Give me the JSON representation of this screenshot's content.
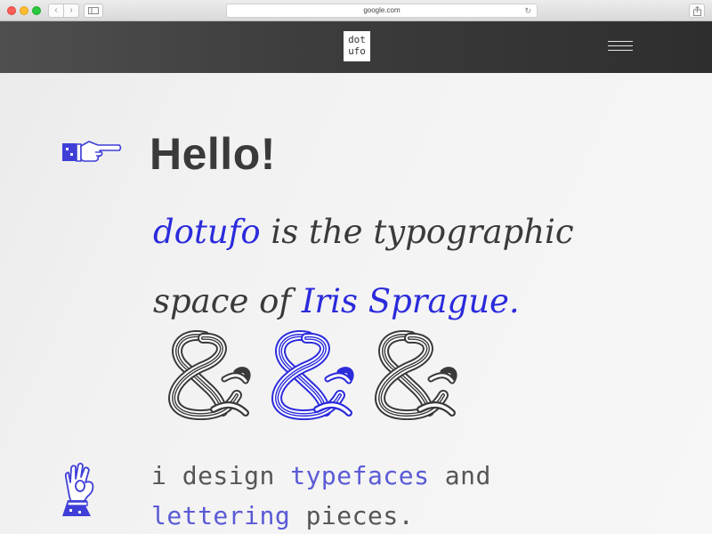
{
  "browser": {
    "url": "google.com",
    "back_glyph": "‹",
    "forward_glyph": "›",
    "reload_glyph": "↻"
  },
  "header": {
    "logo_line1": "dot",
    "logo_line2": "ufo"
  },
  "hero": {
    "greeting": "Hello!",
    "tagline": {
      "part1": "dotufo",
      "part2": " is the typographic",
      "part3": "space of ",
      "part4": "Iris Sprague",
      "part5": "."
    },
    "intro": {
      "part1": "i design ",
      "part2": "typefaces",
      "part3": " and",
      "part4": "lettering",
      "part5": " pieces."
    }
  },
  "icons": {
    "pointing": "pointing-hand-icon",
    "ok": "ok-hand-icon",
    "ampersands": "ampersand-icon"
  },
  "colors": {
    "accent_blue": "#2b2bdc",
    "mono_blue": "#5a5ad6",
    "text_dark": "#3a3a3a",
    "header_dark": "#3a3a3a"
  }
}
